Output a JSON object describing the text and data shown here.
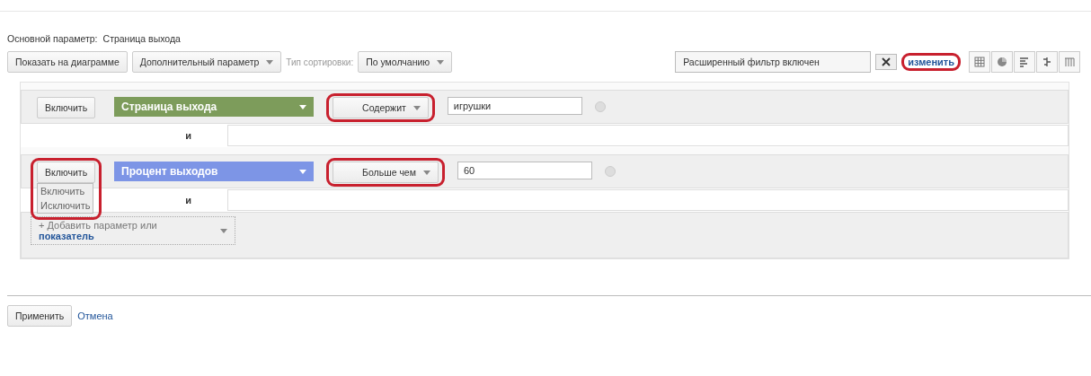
{
  "primary_dimension": {
    "label": "Основной параметр:",
    "value": "Страница выхода"
  },
  "toolbar": {
    "plot_button": "Показать на диаграмме",
    "secondary_dimension": "Дополнительный параметр",
    "sort_label": "Тип сортировки:",
    "sort_value": "По умолчанию",
    "filter_status": "Расширенный фильтр включен",
    "edit_link": "изменить",
    "edit_highlighted": true,
    "views": [
      {
        "kind": "table",
        "selected": false
      },
      {
        "kind": "pie",
        "selected": false
      },
      {
        "kind": "bars",
        "selected": false
      },
      {
        "kind": "compare",
        "selected": false
      },
      {
        "kind": "pivot",
        "selected": false
      }
    ]
  },
  "conditions": [
    {
      "mode": "Включить",
      "mode_highlighted": false,
      "dimension": "Страница выхода",
      "kind": "dimension",
      "operator": "Содержит",
      "operator_highlighted": true,
      "value": "игрушки",
      "connector": "и"
    },
    {
      "mode": "Включить",
      "mode_highlighted": true,
      "menu": [
        "Включить",
        "Исключить"
      ],
      "dimension": "Процент выходов",
      "kind": "metric",
      "operator": "Больше чем",
      "operator_highlighted": true,
      "value": "60",
      "connector": "и"
    }
  ],
  "add": {
    "text": "+ Добавить параметр или",
    "link": "показатель"
  },
  "actions": {
    "apply": "Применить",
    "cancel": "Отмена"
  }
}
